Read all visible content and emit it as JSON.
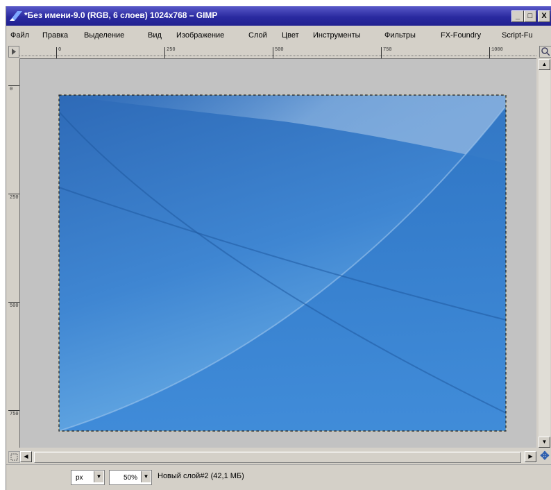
{
  "window": {
    "title": "*Без имени-9.0 (RGB, 6 слоев) 1024x768 – GIMP",
    "controls": {
      "minimize": "_",
      "maximize": "□",
      "close": "X"
    }
  },
  "menu": [
    {
      "label": "Файл"
    },
    {
      "label": "Правка"
    },
    {
      "label": "Выделение"
    },
    {
      "label": "Вид"
    },
    {
      "label": "Изображение"
    },
    {
      "label": "Слой"
    },
    {
      "label": "Цвет"
    },
    {
      "label": "Инструменты"
    },
    {
      "label": "Фильтры"
    },
    {
      "label": "FX-Foundry"
    },
    {
      "label": "Script-Fu"
    }
  ],
  "rulers": {
    "horizontal_labels": [
      "0",
      "250",
      "500",
      "750",
      "1000"
    ],
    "vertical_labels": [
      "0",
      "250",
      "500",
      "750"
    ]
  },
  "icons": {
    "app": "gimp-icon",
    "ruler_corner": "pointer-menu-icon",
    "zoom": "zoom-icon",
    "quick_mask": "quick-mask-icon",
    "navigate": "navigate-icon",
    "dropdown": "dropdown-arrow-icon"
  },
  "status": {
    "unit": "px",
    "zoom": "50%",
    "layer_info": "Новый слой#2 (42,1 МБ)"
  },
  "colors": {
    "title_bar": "#2a2aa0",
    "canvas_bg": "#c2c2c2",
    "image_blue_dark": "#2b6cb8",
    "image_blue_light": "#7fb0de"
  }
}
